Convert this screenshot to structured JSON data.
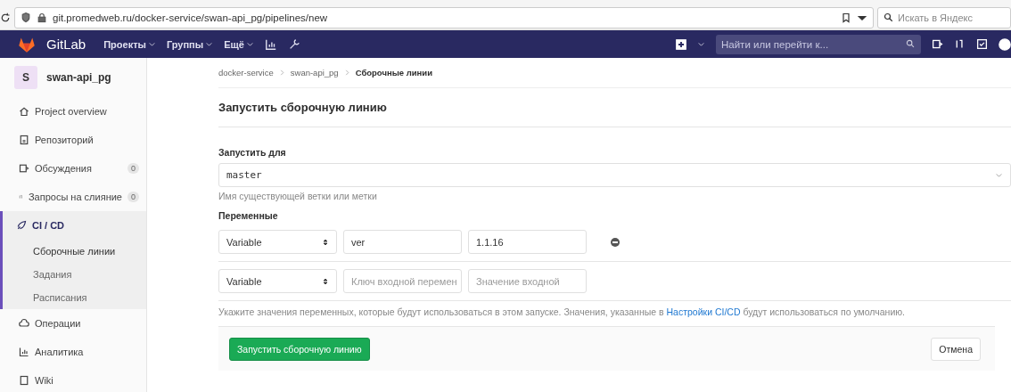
{
  "browser": {
    "url": "git.promedweb.ru/docker-service/swan-api_pg/pipelines/new",
    "search": {
      "placeholder": "Искать в Яндекс"
    }
  },
  "navbar": {
    "brand": "GitLab",
    "menus": [
      {
        "label": "Проекты"
      },
      {
        "label": "Группы"
      },
      {
        "label": "Ещё"
      }
    ],
    "search": {
      "placeholder": "Найти или перейти к..."
    }
  },
  "sidebar": {
    "project": {
      "avatar": "S",
      "name": "swan-api_pg"
    },
    "items": [
      {
        "kind": "overview",
        "label": "Project overview",
        "selected": false
      },
      {
        "kind": "repo",
        "label": "Репозиторий",
        "selected": false
      },
      {
        "kind": "issues",
        "label": "Обсуждения",
        "count": "0",
        "selected": false
      },
      {
        "kind": "merge",
        "label": "Запросы на слияние",
        "count": "0",
        "selected": false
      },
      {
        "kind": "cicd",
        "label": "CI / CD",
        "selected": true,
        "expanded": true,
        "children": [
          {
            "label": "Сборочные линии",
            "selected": true
          },
          {
            "label": "Задания",
            "selected": false
          },
          {
            "label": "Расписания",
            "selected": false
          }
        ]
      },
      {
        "kind": "ops",
        "label": "Операции",
        "selected": false
      },
      {
        "kind": "analytics",
        "label": "Аналитика",
        "selected": false
      },
      {
        "kind": "wiki",
        "label": "Wiki",
        "selected": false
      }
    ]
  },
  "breadcrumbs": [
    "docker-service",
    "swan-api_pg",
    "Сборочные линии"
  ],
  "page_title": "Запустить сборочную линию",
  "run_for": {
    "label": "Запустить для",
    "value": "master",
    "hint": "Имя существующей ветки или метки"
  },
  "variables": {
    "label": "Переменные",
    "rows": [
      {
        "type": "Variable",
        "key": {
          "value": "ver"
        },
        "value": {
          "value": "1.1.16"
        },
        "removable": true
      },
      {
        "type": "Variable",
        "key": {
          "placeholder": "Ключ входной перемен"
        },
        "value": {
          "placeholder": "Значение входной"
        },
        "removable": false
      }
    ],
    "note": {
      "before": "Укажите значения переменных, которые будут использоваться в этом запуске. Значения, указанные в",
      "link": "Настройки CI/CD",
      "after": "будут использоваться по умолчанию."
    }
  },
  "actions": {
    "submit": "Запустить сборочную линию",
    "cancel": "Отмена"
  }
}
